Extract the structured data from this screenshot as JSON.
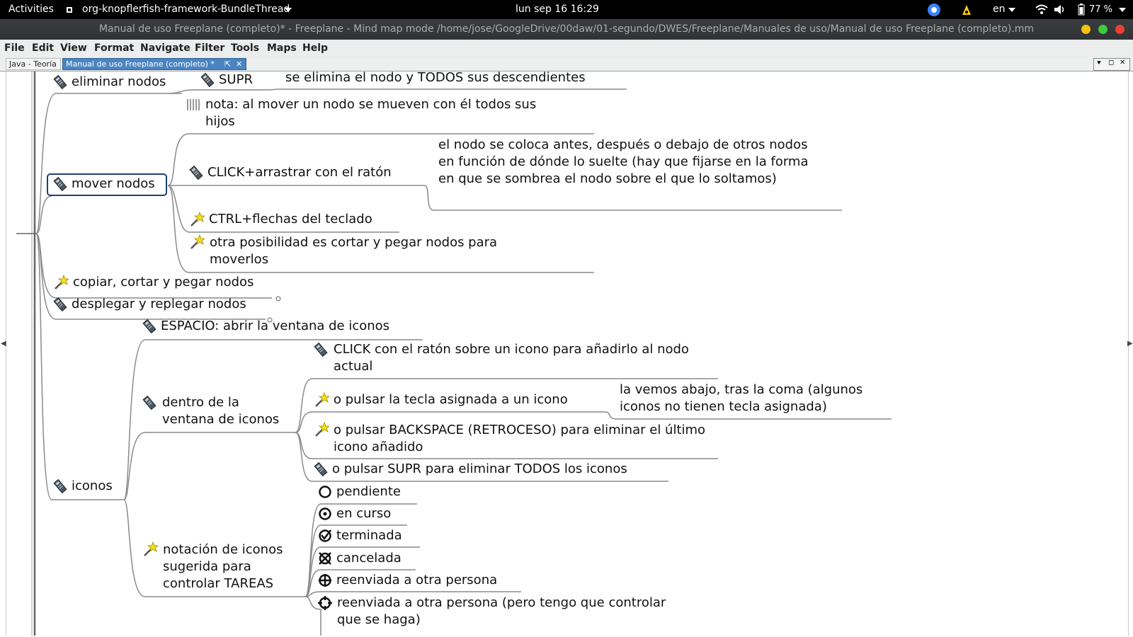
{
  "topbar": {
    "activities": "Activities",
    "app_name": "org-knopflerfish-framework-BundleThread",
    "clock": "lun sep 16  16:29",
    "language": "en",
    "battery": "77 %"
  },
  "window": {
    "title": "Manual de uso Freeplane (completo)* - Freeplane - Mind map mode /home/jose/GoogleDrive/00daw/01-segundo/DWES/Freeplane/Manuales de uso/Manual de uso Freeplane (completo).mm"
  },
  "menu": [
    "File",
    "Edit",
    "View",
    "Format",
    "Navigate",
    "Filter",
    "Tools",
    "Maps",
    "Help"
  ],
  "tabs": [
    {
      "label": "Java - Teoría"
    },
    {
      "label": "Manual de uso Freeplane (completo) *"
    }
  ],
  "nodes": {
    "eliminar": "eliminar nodos",
    "supr": "SUPR",
    "supr_desc": "se elimina el nodo y TODOS sus descendientes",
    "nota": "nota: al mover un nodo se mueven con él todos sus hijos",
    "mover": "mover nodos",
    "click_arrastrar": "CLICK+arrastrar con el ratón",
    "click_desc": "el nodo se coloca antes, después o debajo de otros nodos en función de dónde lo suelte (hay que fijarse en la forma en que se sombrea el nodo sobre el que lo soltamos)",
    "ctrl_flechas": "CTRL+flechas del teclado",
    "cortar_pegar": "otra posibilidad es cortar y pegar nodos para moverlos",
    "copiar": "copiar, cortar y pegar nodos",
    "desplegar": "desplegar y replegar nodos",
    "espacio": "ESPACIO: abrir la ventana de iconos",
    "iconos": "iconos",
    "dentro": "dentro de la ventana de iconos",
    "click_icono": "CLICK con el ratón sobre un icono para añadirlo al nodo actual",
    "pulsar_tecla": "o pulsar la tecla asignada a un icono",
    "tecla_desc": "la vemos abajo, tras la coma (algunos iconos no tienen tecla asignada)",
    "backspace": "o pulsar BACKSPACE (RETROCESO) para eliminar el último icono añadido",
    "supr_todos": "o pulsar SUPR para eliminar TODOS los iconos",
    "notacion": "notación de iconos sugerida para controlar TAREAS",
    "pendiente": "pendiente",
    "en_curso": "en curso",
    "terminada": "terminada",
    "cancelada": "cancelada",
    "reenviada": "reenviada a otra persona",
    "reenviada2": "reenviada a otra persona (pero tengo que controlar que se haga)"
  },
  "icons": {
    "note": "clipboard-icon",
    "idea": "magic-wand-icon",
    "todo": "circle-icon"
  },
  "colors": {
    "selection": "#1f3f7a",
    "tab_active": "#4a85c2",
    "edge": "#8a8a8a"
  }
}
